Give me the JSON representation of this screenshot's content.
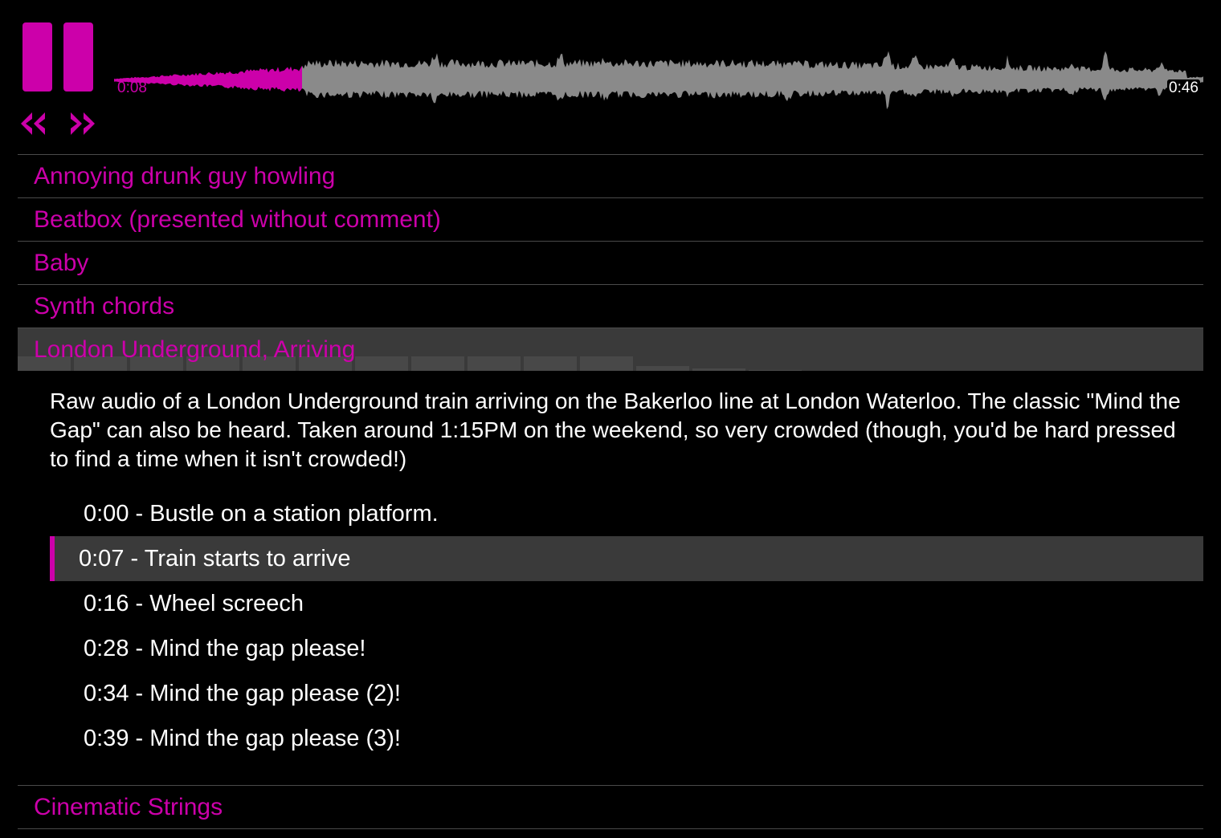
{
  "colors": {
    "accent": "#cc00aa",
    "waveform_unplayed": "#8a8a8a",
    "background": "#000000",
    "text": "#ffffff",
    "highlight_bg": "#3a3a3a"
  },
  "player": {
    "pause_icon": "pause-icon",
    "rewind_icon": "double-chevron-left-icon",
    "forward_icon": "double-chevron-right-icon",
    "current_time": "0:08",
    "total_time": "0:46",
    "progress": 0.174
  },
  "tracks": [
    {
      "title": "Annoying drunk guy howling"
    },
    {
      "title": "Beatbox (presented without comment)"
    },
    {
      "title": "Baby"
    },
    {
      "title": "Synth chords"
    },
    {
      "title": "London Underground, Arriving",
      "description": "Raw audio of a London Underground train arriving on the Bakerloo line at London Waterloo. The classic \"Mind the Gap\" can also be heard. Taken around 1:15PM on the weekend, so very crowded (though, you'd be hard pressed to find a time when it isn't crowded!)",
      "chapters": [
        "0:00 - Bustle on a station platform.",
        "0:07 - Train starts to arrive",
        "0:16 - Wheel screech",
        "0:28 - Mind the gap please!",
        "0:34 - Mind the gap please (2)!",
        "0:39 - Mind the gap please (3)!"
      ]
    },
    {
      "title": "Cinematic Strings"
    }
  ]
}
